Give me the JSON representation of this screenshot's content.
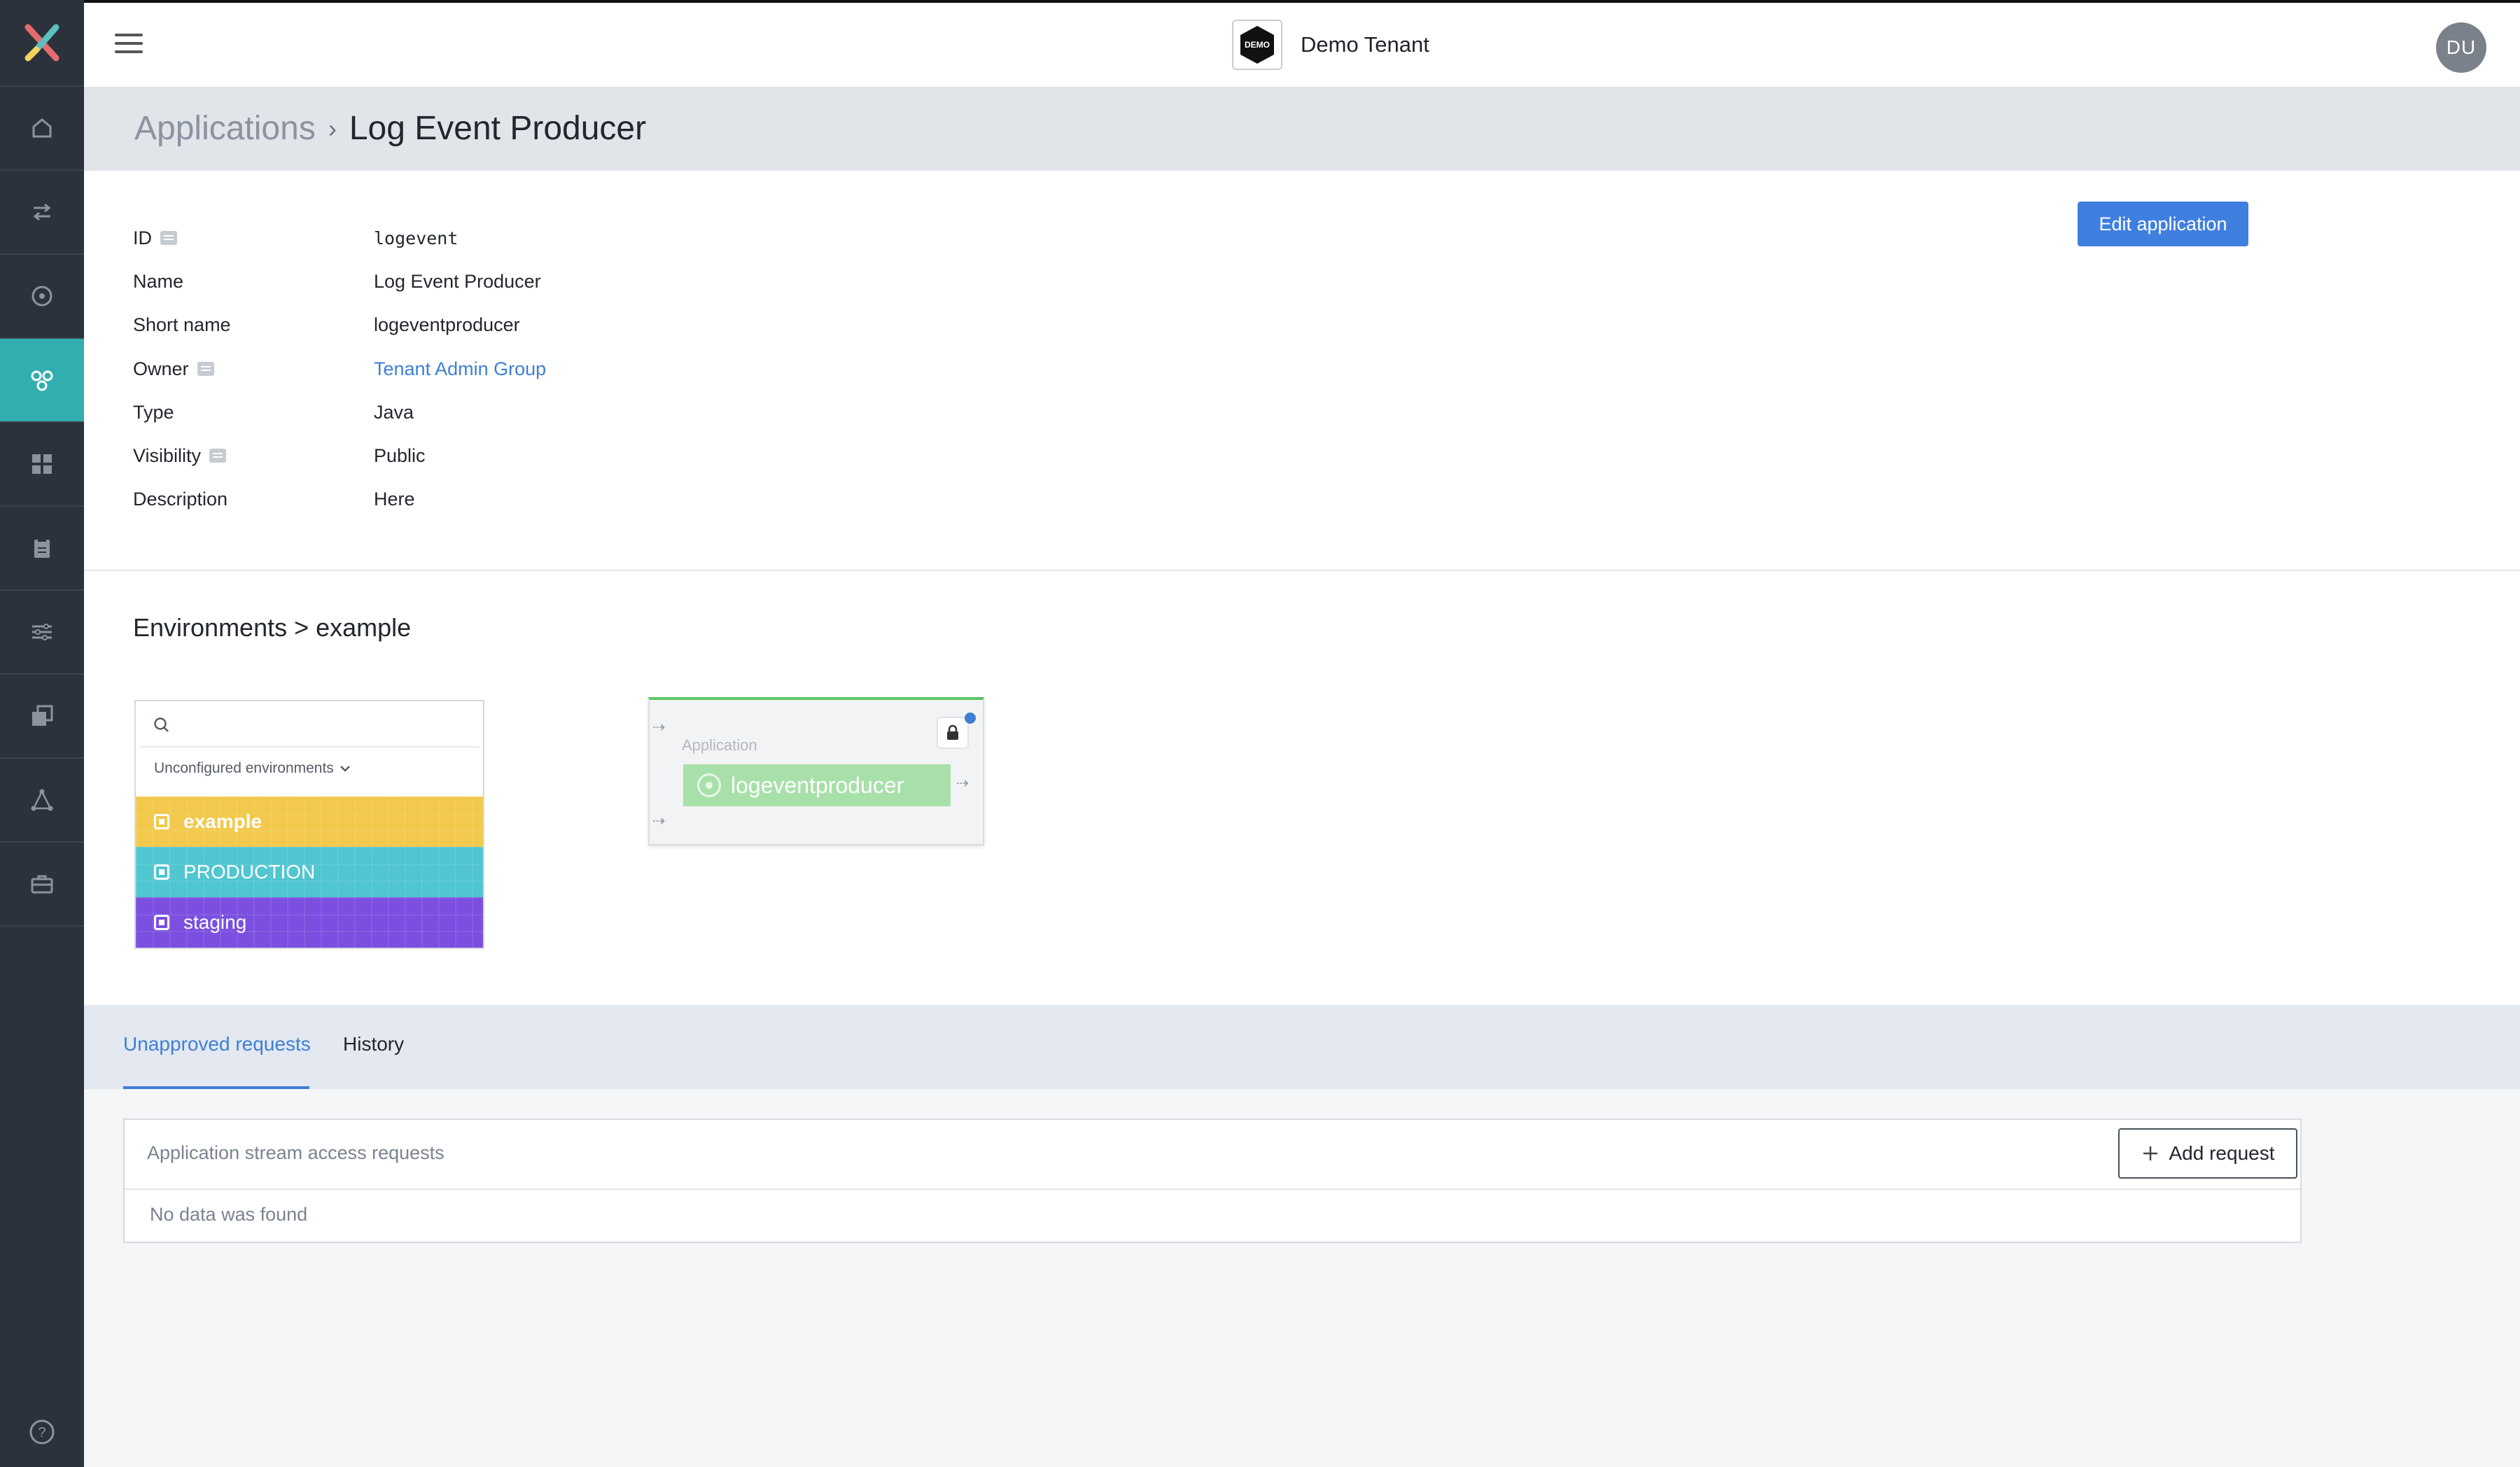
{
  "topbar": {
    "tenant_logo_text": "DEMO",
    "tenant_name": "Demo Tenant",
    "avatar_initials": "DU"
  },
  "breadcrumb": {
    "root": "Applications",
    "separator": "›",
    "current": "Log Event Producer"
  },
  "details": {
    "edit_button": "Edit application",
    "fields": [
      {
        "label": "ID",
        "value": "logevent"
      },
      {
        "label": "Name",
        "value": "Log Event Producer"
      },
      {
        "label": "Short name",
        "value": "logeventproducer"
      },
      {
        "label": "Owner",
        "value": "Tenant Admin Group"
      },
      {
        "label": "Type",
        "value": "Java"
      },
      {
        "label": "Visibility",
        "value": "Public"
      },
      {
        "label": "Description",
        "value": "Here"
      }
    ]
  },
  "environments": {
    "title": "Environments > example",
    "filter_label": "Unconfigured environments",
    "items": [
      {
        "name": "example",
        "color": "#f2c94c"
      },
      {
        "name": "PRODUCTION",
        "color": "#4fc6d0"
      },
      {
        "name": "staging",
        "color": "#7b4fe0"
      }
    ],
    "app_card": {
      "label": "Application",
      "name": "logeventproducer"
    }
  },
  "tabs": {
    "unapproved": "Unapproved requests",
    "history": "History"
  },
  "requests": {
    "title": "Application stream access requests",
    "add_button": "Add request",
    "empty": "No data was found"
  },
  "colors": {
    "accent": "#3f7fe0",
    "sidebar": "#2b323b",
    "sidebar_active": "#33aeb0"
  }
}
